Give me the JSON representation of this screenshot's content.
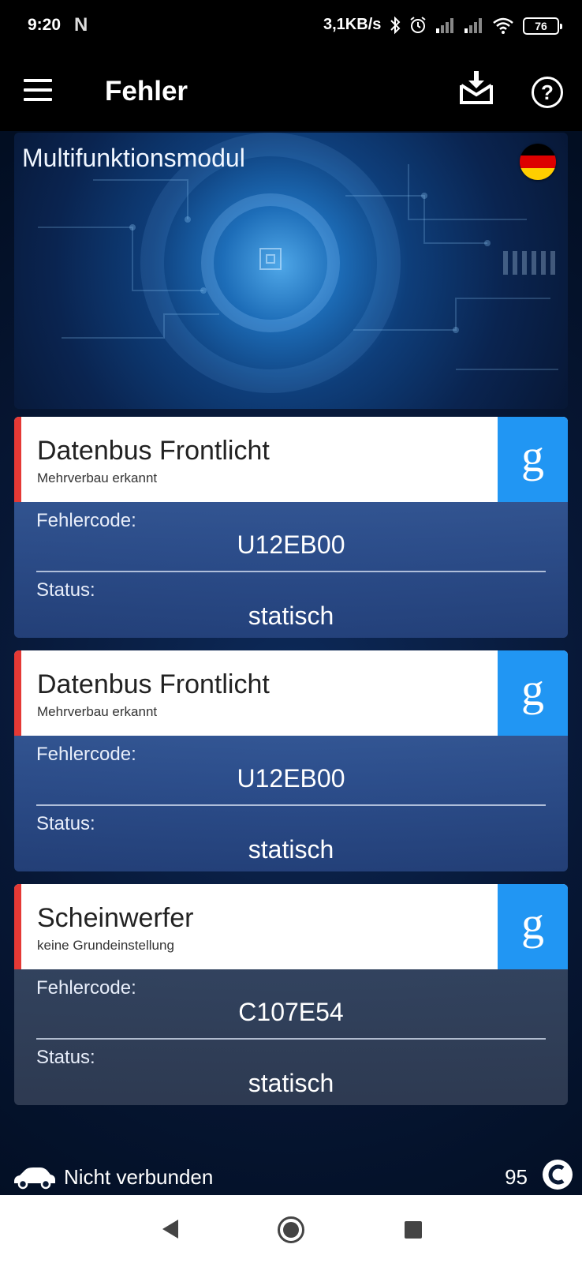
{
  "status_bar": {
    "time": "9:20",
    "notif_letter": "N",
    "net_speed": "3,1KB/s",
    "battery": "76",
    "icons": [
      "bluetooth-icon",
      "alarm-icon",
      "signal-icon",
      "signal-icon",
      "wifi-icon",
      "battery-icon"
    ]
  },
  "app_bar": {
    "title": "Fehler",
    "icons": [
      "menu-icon",
      "save-download-icon",
      "help-icon"
    ]
  },
  "banner": {
    "title": "Multifunktionsmodul",
    "flag": "germany-flag-icon",
    "flag_colors": [
      "#000000",
      "#dd0000",
      "#ffce00"
    ]
  },
  "labels": {
    "code": "Fehlercode:",
    "status": "Status:"
  },
  "errors": [
    {
      "title": "Datenbus Frontlicht",
      "subtitle": "Mehrverbau erkannt",
      "code": "U12EB00",
      "status": "statisch"
    },
    {
      "title": "Datenbus Frontlicht",
      "subtitle": "Mehrverbau erkannt",
      "code": "U12EB00",
      "status": "statisch"
    },
    {
      "title": "Scheinwerfer",
      "subtitle": "keine Grundeinstellung",
      "code": "C107E54",
      "status": "statisch"
    }
  ],
  "google_button": {
    "glyph": "g",
    "icon": "google-search-icon"
  },
  "colors": {
    "accent_blue": "#2196f3",
    "error_red": "#e53935"
  },
  "footer": {
    "connection": "Nicht verbunden",
    "count": "95",
    "icons": [
      "car-icon",
      "credits-icon"
    ]
  },
  "nav": {
    "icons": [
      "back-icon",
      "home-icon",
      "recents-icon"
    ]
  }
}
